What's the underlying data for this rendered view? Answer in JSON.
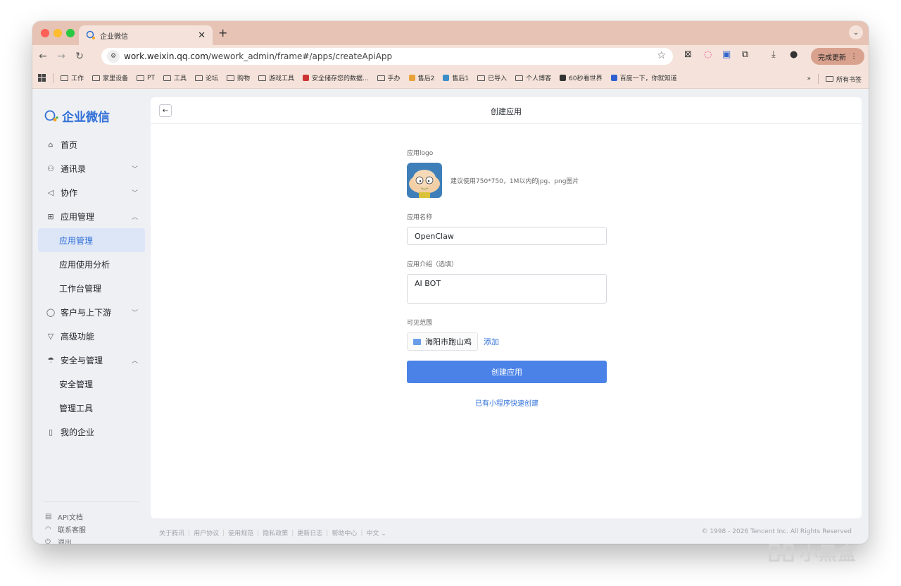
{
  "browser": {
    "tab_title": "企业微信",
    "url_host": "work.weixin.qq.com",
    "url_path": "/wework_admin/frame#/apps/createApiApp",
    "update_button": "完成更新",
    "bookmarks": [
      {
        "label": "工作",
        "icon": "folder-icon"
      },
      {
        "label": "家里设备",
        "icon": "folder-icon"
      },
      {
        "label": "PT",
        "icon": "folder-icon"
      },
      {
        "label": "工具",
        "icon": "folder-icon"
      },
      {
        "label": "论坛",
        "icon": "folder-icon"
      },
      {
        "label": "购物",
        "icon": "folder-icon"
      },
      {
        "label": "游戏工具",
        "icon": "folder-icon"
      },
      {
        "label": "安全储存您的数据...",
        "icon": "shield-icon"
      },
      {
        "label": "手办",
        "icon": "folder-icon"
      },
      {
        "label": "售后2",
        "icon": "grid-color-icon"
      },
      {
        "label": "售后1",
        "icon": "fish-icon"
      },
      {
        "label": "已导入",
        "icon": "folder-icon"
      },
      {
        "label": "个人博客",
        "icon": "folder-icon"
      },
      {
        "label": "60秒看世界",
        "icon": "avatar-icon"
      },
      {
        "label": "百度一下，你就知道",
        "icon": "paw-icon"
      }
    ],
    "bookmarks_overflow": "»",
    "all_bookmarks": "所有书签"
  },
  "sidebar": {
    "brand": "企业微信",
    "items": [
      {
        "label": "首页",
        "icon": "home-icon",
        "level": 0
      },
      {
        "label": "通讯录",
        "icon": "org-icon",
        "level": 0,
        "chevron": "﹀"
      },
      {
        "label": "协作",
        "icon": "collab-icon",
        "level": 0,
        "chevron": "﹀"
      },
      {
        "label": "应用管理",
        "icon": "apps-icon",
        "level": 0,
        "chevron": "︿"
      },
      {
        "label": "应用管理",
        "level": 1,
        "active": true
      },
      {
        "label": "应用使用分析",
        "level": 1
      },
      {
        "label": "工作台管理",
        "level": 1
      },
      {
        "label": "客户与上下游",
        "icon": "chat-icon",
        "level": 0,
        "chevron": "﹀"
      },
      {
        "label": "高级功能",
        "icon": "diamond-icon",
        "level": 0
      },
      {
        "label": "安全与管理",
        "icon": "umbrella-icon",
        "level": 0,
        "chevron": "︿"
      },
      {
        "label": "安全管理",
        "level": 1
      },
      {
        "label": "管理工具",
        "level": 1
      },
      {
        "label": "我的企业",
        "icon": "building-icon",
        "level": 0
      }
    ],
    "footer": [
      {
        "label": "API文档",
        "icon": "doc-icon"
      },
      {
        "label": "联系客服",
        "icon": "headset-icon"
      },
      {
        "label": "退出",
        "icon": "power-icon"
      }
    ]
  },
  "main": {
    "title": "创建应用",
    "logo_label": "应用logo",
    "logo_hint": "建议使用750*750，1M以内的jpg、png图片",
    "name_label": "应用名称",
    "name_value": "OpenClaw",
    "intro_label": "应用介绍（选填）",
    "intro_value": "AI BOT",
    "scope_label": "可见范围",
    "scope_value": "海阳市跑山鸡",
    "add_label": "添加",
    "create_button": "创建应用",
    "mini_program_link": "已有小程序快速创建"
  },
  "footer": {
    "links": [
      "关于腾讯",
      "用户协议",
      "使用规范",
      "隐私政策",
      "更新日志",
      "帮助中心",
      "中文 ⌄"
    ],
    "copyright": "© 1998 - 2026 Tencent Inc. All Rights Reserved"
  },
  "watermark": "小黑盒",
  "colors": {
    "accent": "#2f6fd6",
    "button": "#4b82e8",
    "tab_strip": "#e6c3b4",
    "toolbar": "#f5e3db",
    "sidebar_bg": "#eef0f4"
  }
}
